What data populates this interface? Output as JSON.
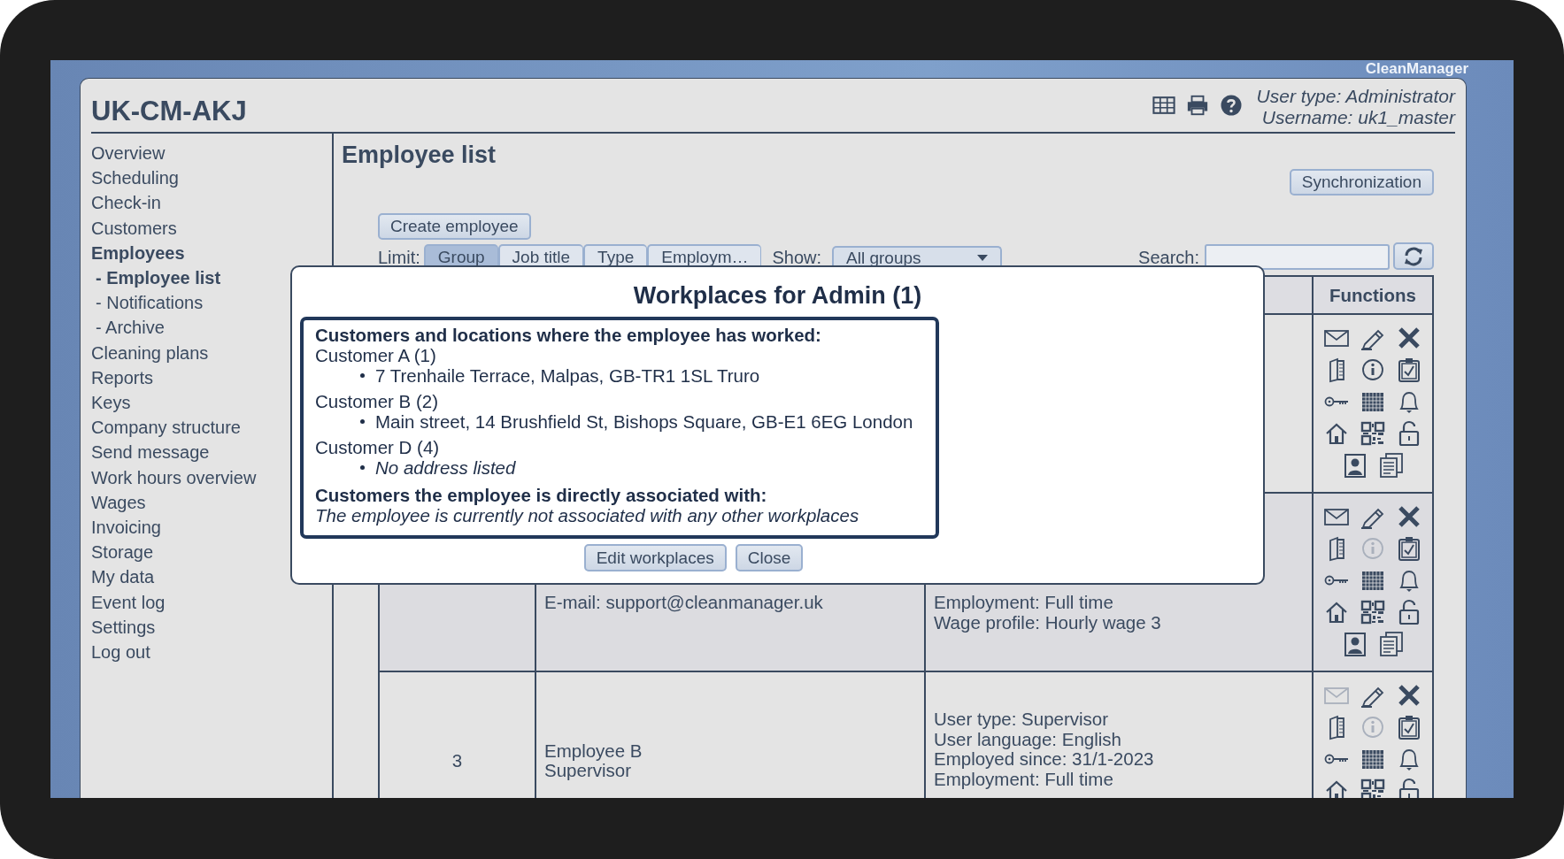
{
  "app_label": "CleanManager",
  "header": {
    "title": "UK-CM-AKJ",
    "user_type": "User type: Administrator",
    "username": "Username: uk1_master"
  },
  "sidebar": {
    "items": [
      {
        "label": "Overview",
        "selected": false
      },
      {
        "label": "Scheduling",
        "selected": false
      },
      {
        "label": "Check-in",
        "selected": false
      },
      {
        "label": "Customers",
        "selected": false
      },
      {
        "label": "Employees",
        "selected": true,
        "children": [
          {
            "label": "- Employee list",
            "selected": true
          },
          {
            "label": "- Notifications",
            "selected": false
          },
          {
            "label": "- Archive",
            "selected": false
          }
        ]
      },
      {
        "label": "Cleaning plans",
        "selected": false
      },
      {
        "label": "Reports",
        "selected": false
      },
      {
        "label": "Keys",
        "selected": false
      },
      {
        "label": "Company structure",
        "selected": false
      },
      {
        "label": "Send message",
        "selected": false
      },
      {
        "label": "Work hours overview",
        "selected": false
      },
      {
        "label": "Wages",
        "selected": false
      },
      {
        "label": "Invoicing",
        "selected": false
      },
      {
        "label": "Storage",
        "selected": false
      },
      {
        "label": "My data",
        "selected": false
      },
      {
        "label": "Event log",
        "selected": false
      },
      {
        "label": "Settings",
        "selected": false
      },
      {
        "label": "Log out",
        "selected": false
      }
    ]
  },
  "page": {
    "title": "Employee list",
    "sync_button": "Synchronization",
    "create_button": "Create employee",
    "limit_label": "Limit:",
    "limit_tabs": [
      {
        "label": "Group",
        "selected": true
      },
      {
        "label": "Job title",
        "selected": false
      },
      {
        "label": "Type",
        "selected": false
      },
      {
        "label": "Employm…",
        "selected": false
      }
    ],
    "show_label": "Show:",
    "show_value": "All groups",
    "search_label": "Search:"
  },
  "table": {
    "functions_header": "Functions",
    "rows": [
      {
        "number": "",
        "name_lines": [],
        "detail_lines": [],
        "functions": [
          {
            "kind": "mail",
            "disabled": false
          },
          {
            "kind": "pencil",
            "disabled": false
          },
          {
            "kind": "delete",
            "disabled": false
          },
          {
            "kind": "book",
            "disabled": false
          },
          {
            "kind": "info",
            "disabled": false
          },
          {
            "kind": "clipboard",
            "disabled": false
          },
          {
            "kind": "key",
            "disabled": false
          },
          {
            "kind": "calendar",
            "disabled": false
          },
          {
            "kind": "bell",
            "disabled": false
          },
          {
            "kind": "house",
            "disabled": false
          },
          {
            "kind": "qr",
            "disabled": false
          },
          {
            "kind": "padlock",
            "disabled": false
          },
          {
            "kind": "portrait",
            "disabled": false
          },
          {
            "kind": "documents",
            "disabled": false
          }
        ]
      },
      {
        "number": "",
        "name_lines": [
          "E-mail: support@cleanmanager.uk"
        ],
        "detail_lines": [
          "Employment: Full time",
          "Wage profile: Hourly wage 3"
        ],
        "functions": [
          {
            "kind": "mail",
            "disabled": false
          },
          {
            "kind": "pencil",
            "disabled": false
          },
          {
            "kind": "delete",
            "disabled": false
          },
          {
            "kind": "book",
            "disabled": false
          },
          {
            "kind": "info",
            "disabled": true
          },
          {
            "kind": "clipboard",
            "disabled": false
          },
          {
            "kind": "key",
            "disabled": false
          },
          {
            "kind": "calendar",
            "disabled": false
          },
          {
            "kind": "bell",
            "disabled": false
          },
          {
            "kind": "house",
            "disabled": false
          },
          {
            "kind": "qr",
            "disabled": false
          },
          {
            "kind": "padlock",
            "disabled": false
          },
          {
            "kind": "portrait",
            "disabled": false
          },
          {
            "kind": "documents",
            "disabled": false
          }
        ]
      },
      {
        "number": "3",
        "name_lines": [
          "Employee B",
          "Supervisor"
        ],
        "detail_lines": [
          "User type: Supervisor",
          "User language: English",
          "Employed since: 31/1-2023",
          "Employment: Full time"
        ],
        "functions": [
          {
            "kind": "mail",
            "disabled": true
          },
          {
            "kind": "pencil",
            "disabled": false
          },
          {
            "kind": "delete",
            "disabled": false
          },
          {
            "kind": "book",
            "disabled": false
          },
          {
            "kind": "info",
            "disabled": true
          },
          {
            "kind": "clipboard",
            "disabled": false
          },
          {
            "kind": "key",
            "disabled": false
          },
          {
            "kind": "calendar",
            "disabled": false
          },
          {
            "kind": "bell",
            "disabled": false
          },
          {
            "kind": "house",
            "disabled": false
          },
          {
            "kind": "qr",
            "disabled": false
          },
          {
            "kind": "padlock",
            "disabled": false
          }
        ]
      }
    ]
  },
  "dialog": {
    "title": "Workplaces for Admin (1)",
    "worked_heading": "Customers and locations where the employee has worked:",
    "customers": [
      {
        "name": "Customer A (1)",
        "addresses": [
          {
            "text": "7 Trenhaile Terrace, Malpas, GB-TR1 1SL Truro",
            "italic": false
          }
        ]
      },
      {
        "name": "Customer B (2)",
        "addresses": [
          {
            "text": "Main street, 14 Brushfield St, Bishops Square, GB-E1 6EG London",
            "italic": false
          }
        ]
      },
      {
        "name": "Customer D (4)",
        "addresses": [
          {
            "text": "No address listed",
            "italic": true
          }
        ]
      }
    ],
    "associated_heading": "Customers the employee is directly associated with:",
    "associated_note": "The employee is currently not associated with any other workplaces",
    "buttons": [
      "Edit workplaces",
      "Close"
    ]
  }
}
